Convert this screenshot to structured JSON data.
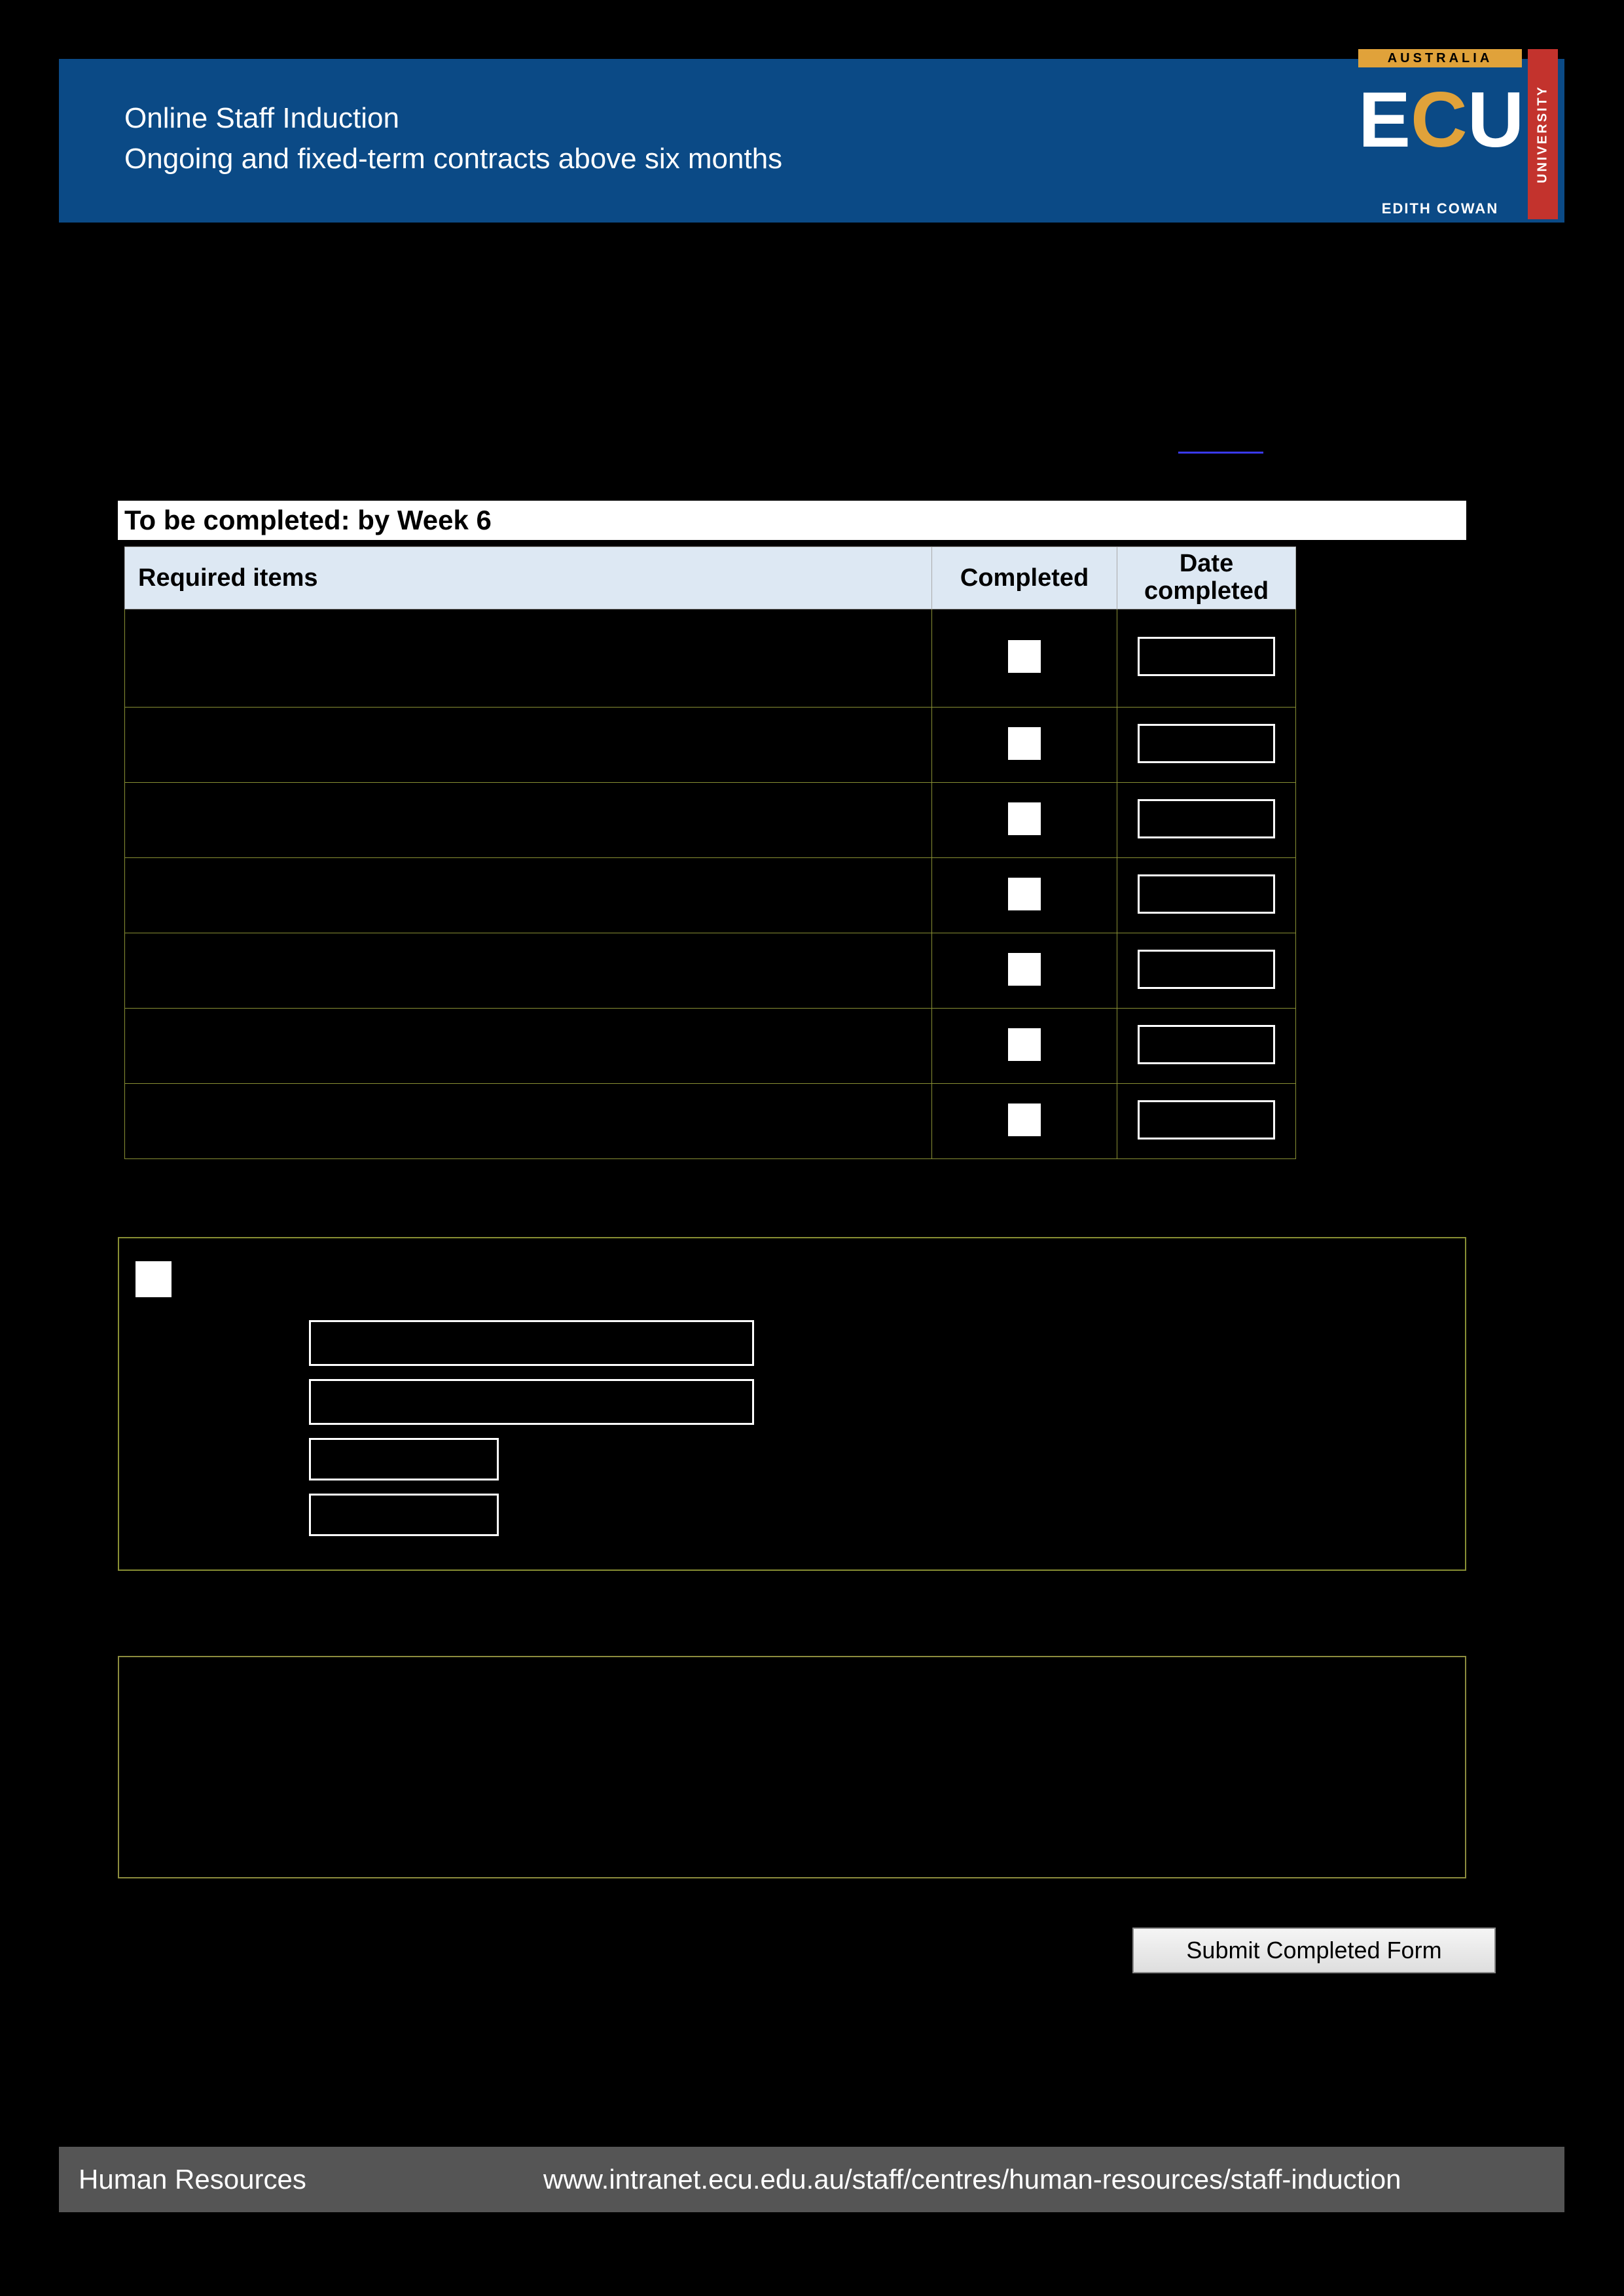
{
  "header": {
    "title": "Online Staff Induction",
    "subtitle": "Ongoing and fixed-term contracts above six months"
  },
  "logo": {
    "australia": "AUSTRALIA",
    "ecu_e": "E",
    "ecu_c": "C",
    "ecu_u": "U",
    "edith_cowan": "EDITH COWAN",
    "university": "UNIVERSITY"
  },
  "section": {
    "bar": "To be completed: by Week 6"
  },
  "table": {
    "headers": {
      "required": "Required items",
      "completed": "Completed",
      "date": "Date completed"
    }
  },
  "submit": {
    "label": "Submit Completed Form"
  },
  "footer": {
    "left": "Human Resources",
    "right": "www.intranet.ecu.edu.au/staff/centres/human-resources/staff-induction"
  }
}
